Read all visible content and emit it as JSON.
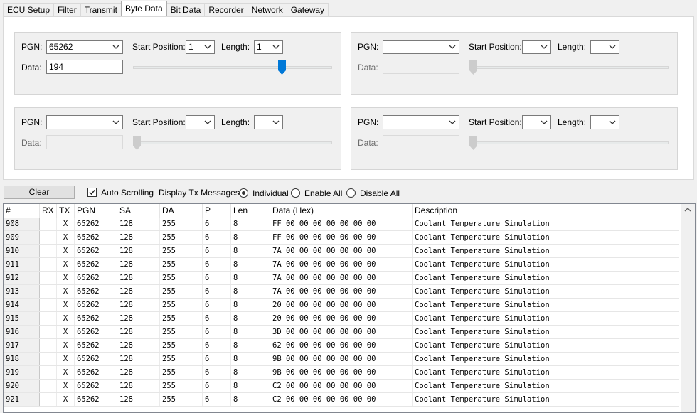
{
  "tabs": [
    "ECU Setup",
    "Filter",
    "Transmit",
    "Byte Data",
    "Bit Data",
    "Recorder",
    "Network",
    "Gateway"
  ],
  "active_tab": "Byte Data",
  "panels": [
    {
      "pgn_label": "PGN:",
      "pgn_value": "65262",
      "start_label": "Start Position:",
      "start_value": "1",
      "length_label": "Length:",
      "length_value": "1",
      "data_label": "Data:",
      "data_value": "194",
      "enabled": true
    },
    {
      "pgn_label": "PGN:",
      "pgn_value": "",
      "start_label": "Start Position:",
      "start_value": "",
      "length_label": "Length:",
      "length_value": "",
      "data_label": "Data:",
      "data_value": "",
      "enabled": false
    },
    {
      "pgn_label": "PGN:",
      "pgn_value": "",
      "start_label": "Start Position:",
      "start_value": "",
      "length_label": "Length:",
      "length_value": "",
      "data_label": "Data:",
      "data_value": "",
      "enabled": false
    },
    {
      "pgn_label": "PGN:",
      "pgn_value": "",
      "start_label": "Start Position:",
      "start_value": "",
      "length_label": "Length:",
      "length_value": "",
      "data_label": "Data:",
      "data_value": "",
      "enabled": false
    }
  ],
  "slider_level": 0.76,
  "toolbar": {
    "clear_label": "Clear",
    "auto_scrolling_label": "Auto Scrolling",
    "auto_scrolling_checked": true,
    "display_tx_label": "Display Tx Messages:",
    "radio_individual": "Individual",
    "radio_enable_all": "Enable All",
    "radio_disable_all": "Disable All",
    "radio_selected": "Individual"
  },
  "grid": {
    "columns": [
      "#",
      "RX",
      "TX",
      "PGN",
      "SA",
      "DA",
      "P",
      "Len",
      "Data (Hex)",
      "Description"
    ],
    "rows": [
      [
        "908",
        "",
        "X",
        "65262",
        "128",
        "255",
        "6",
        "8",
        "FF 00 00 00 00 00 00 00",
        "Coolant Temperature Simulation"
      ],
      [
        "909",
        "",
        "X",
        "65262",
        "128",
        "255",
        "6",
        "8",
        "FF 00 00 00 00 00 00 00",
        "Coolant Temperature Simulation"
      ],
      [
        "910",
        "",
        "X",
        "65262",
        "128",
        "255",
        "6",
        "8",
        "7A 00 00 00 00 00 00 00",
        "Coolant Temperature Simulation"
      ],
      [
        "911",
        "",
        "X",
        "65262",
        "128",
        "255",
        "6",
        "8",
        "7A 00 00 00 00 00 00 00",
        "Coolant Temperature Simulation"
      ],
      [
        "912",
        "",
        "X",
        "65262",
        "128",
        "255",
        "6",
        "8",
        "7A 00 00 00 00 00 00 00",
        "Coolant Temperature Simulation"
      ],
      [
        "913",
        "",
        "X",
        "65262",
        "128",
        "255",
        "6",
        "8",
        "7A 00 00 00 00 00 00 00",
        "Coolant Temperature Simulation"
      ],
      [
        "914",
        "",
        "X",
        "65262",
        "128",
        "255",
        "6",
        "8",
        "20 00 00 00 00 00 00 00",
        "Coolant Temperature Simulation"
      ],
      [
        "915",
        "",
        "X",
        "65262",
        "128",
        "255",
        "6",
        "8",
        "20 00 00 00 00 00 00 00",
        "Coolant Temperature Simulation"
      ],
      [
        "916",
        "",
        "X",
        "65262",
        "128",
        "255",
        "6",
        "8",
        "3D 00 00 00 00 00 00 00",
        "Coolant Temperature Simulation"
      ],
      [
        "917",
        "",
        "X",
        "65262",
        "128",
        "255",
        "6",
        "8",
        "62 00 00 00 00 00 00 00",
        "Coolant Temperature Simulation"
      ],
      [
        "918",
        "",
        "X",
        "65262",
        "128",
        "255",
        "6",
        "8",
        "9B 00 00 00 00 00 00 00",
        "Coolant Temperature Simulation"
      ],
      [
        "919",
        "",
        "X",
        "65262",
        "128",
        "255",
        "6",
        "8",
        "9B 00 00 00 00 00 00 00",
        "Coolant Temperature Simulation"
      ],
      [
        "920",
        "",
        "X",
        "65262",
        "128",
        "255",
        "6",
        "8",
        "C2 00 00 00 00 00 00 00",
        "Coolant Temperature Simulation"
      ],
      [
        "921",
        "",
        "X",
        "65262",
        "128",
        "255",
        "6",
        "8",
        "C2 00 00 00 00 00 00 00",
        "Coolant Temperature Simulation"
      ]
    ]
  },
  "icons": {
    "combo_arrow": "chevron-down-icon",
    "scroll_up": "chevron-up-icon",
    "checkbox": "checkmark-icon",
    "slider_thumb": "slider-thumb-icon"
  },
  "colors": {
    "accent": "#0078d7",
    "window_bg": "#f0f0f0",
    "disabled_text": "#6d6d6d",
    "thumb_disabled": "#cccccc"
  }
}
